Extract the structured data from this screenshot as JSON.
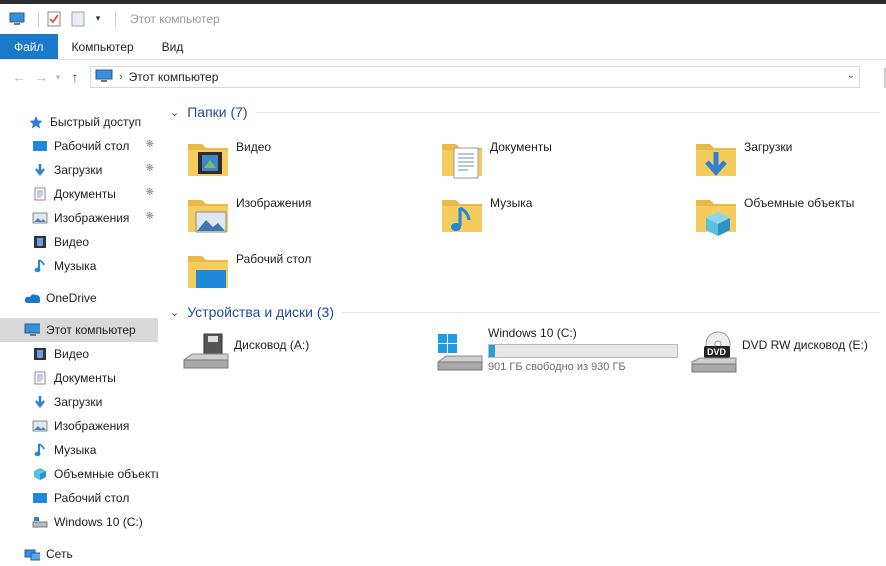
{
  "window": {
    "title": "Этот компьютер"
  },
  "ribbon": {
    "tabs": [
      "Файл",
      "Компьютер",
      "Вид"
    ]
  },
  "address": {
    "path": "Этот компьютер"
  },
  "nav": {
    "quick_access": "Быстрый доступ",
    "quick_items": [
      "Рабочий стол",
      "Загрузки",
      "Документы",
      "Изображения",
      "Видео",
      "Музыка"
    ],
    "onedrive": "OneDrive",
    "this_pc": "Этот компьютер",
    "pc_items": [
      "Видео",
      "Документы",
      "Загрузки",
      "Изображения",
      "Музыка",
      "Объемные объекты",
      "Рабочий стол",
      "Windows 10 (C:)"
    ],
    "network": "Сеть"
  },
  "folders": {
    "header": "Папки (7)",
    "items": [
      "Видео",
      "Документы",
      "Загрузки",
      "Изображения",
      "Музыка",
      "Объемные объекты",
      "Рабочий стол"
    ]
  },
  "devices": {
    "header": "Устройства и диски (3)",
    "items": [
      {
        "name": "Дисковод (A:)"
      },
      {
        "name": "Windows 10 (C:)",
        "free_text": "901 ГБ свободно из 930 ГБ",
        "used_fraction": 0.031
      },
      {
        "name": "DVD RW дисковод (E:)",
        "badge": "DVD"
      }
    ]
  },
  "colors": {
    "accent": "#1979ca",
    "folder": "#f5cd5e",
    "bar_fill": "#26a0da"
  }
}
